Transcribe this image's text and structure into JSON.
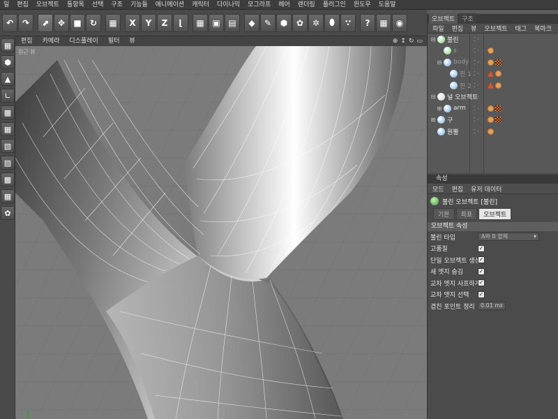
{
  "menubar": {
    "items": [
      "일",
      "편집",
      "오브젝트",
      "툴항목",
      "선택",
      "구조",
      "기능들",
      "애니메이션",
      "캐릭터",
      "다이나믹",
      "모그라프",
      "헤어",
      "렌더링",
      "플러그인",
      "윈도우",
      "도움말"
    ]
  },
  "toolbar": {
    "buttons": [
      {
        "name": "undo-icon",
        "glyph": "↶"
      },
      {
        "name": "redo-icon",
        "glyph": "↷"
      },
      {
        "name": "live-select-icon",
        "glyph": "⬈"
      },
      {
        "name": "move-icon",
        "glyph": "✥"
      },
      {
        "name": "scale-icon",
        "glyph": "■"
      },
      {
        "name": "rotate-icon",
        "glyph": "↻"
      },
      {
        "name": "clapboard-icon",
        "glyph": "▦"
      },
      {
        "name": "x-axis-icon",
        "glyph": "X"
      },
      {
        "name": "y-axis-icon",
        "glyph": "Y"
      },
      {
        "name": "z-axis-icon",
        "glyph": "Z"
      },
      {
        "name": "coordinate-system-icon",
        "glyph": "⌊"
      },
      {
        "name": "render-view-icon",
        "glyph": "▦"
      },
      {
        "name": "render-picture-viewer-icon",
        "glyph": "▣"
      },
      {
        "name": "render-settings-icon",
        "glyph": "▤"
      },
      {
        "name": "cube-primitive-icon",
        "glyph": "◆"
      },
      {
        "name": "spline-pen-icon",
        "glyph": "✎"
      },
      {
        "name": "subdivision-icon",
        "glyph": "⬢"
      },
      {
        "name": "array-icon",
        "glyph": "✿"
      },
      {
        "name": "deformer-icon",
        "glyph": "✲"
      },
      {
        "name": "scene-object-icon",
        "glyph": "⬮"
      },
      {
        "name": "particle-icon",
        "glyph": "∵"
      },
      {
        "name": "help-icon",
        "glyph": "?"
      },
      {
        "name": "calculator-icon",
        "glyph": "▦"
      },
      {
        "name": "globe-icon",
        "glyph": "◉"
      }
    ]
  },
  "lefttoolbar": {
    "buttons": [
      {
        "name": "make-editable-icon",
        "glyph": "▦"
      },
      {
        "name": "model-mode-icon",
        "glyph": "⬢"
      },
      {
        "name": "object-axis-icon",
        "glyph": "▲"
      },
      {
        "name": "texture-axis-icon",
        "glyph": "∟"
      },
      {
        "name": "points-mode-icon",
        "glyph": "▩"
      },
      {
        "name": "edges-mode-icon",
        "glyph": "▦"
      },
      {
        "name": "polygons-mode-icon",
        "glyph": "▧"
      },
      {
        "name": "uv-mode-icon",
        "glyph": "▨"
      },
      {
        "name": "enable-axis-icon",
        "glyph": "▩"
      },
      {
        "name": "tweak-mode-icon",
        "glyph": "▦"
      },
      {
        "name": "snap-icon",
        "glyph": "✿"
      }
    ]
  },
  "viewport": {
    "menu": [
      "편집",
      "카메라",
      "디스플레이",
      "필터",
      "뷰"
    ],
    "label": "원근 뷰",
    "nav_icons": [
      "⊕",
      "↕",
      "↻",
      "▭"
    ]
  },
  "object_manager": {
    "tabs": [
      "오브젝트",
      "구조"
    ],
    "menu": [
      "파일",
      "편집",
      "뷰",
      "오브젝트",
      "태그",
      "북마크"
    ],
    "rows": [
      {
        "indent": 0,
        "tree": "⊟",
        "icon_color": "#7fd07a",
        "name": "불린",
        "dim": false,
        "tags": []
      },
      {
        "indent": 1,
        "tree": "",
        "icon_color": "#7fd07a",
        "name": "s",
        "dim": true,
        "tags": [
          "b"
        ]
      },
      {
        "indent": 1,
        "tree": "⊟",
        "icon_color": "#6fb0e0",
        "name": "body",
        "dim": true,
        "tags": [
          "b",
          "c"
        ]
      },
      {
        "indent": 2,
        "tree": "",
        "icon_color": "#6fb0e0",
        "name": "핀 1",
        "dim": true,
        "tags": [
          "t",
          "b"
        ]
      },
      {
        "indent": 2,
        "tree": "",
        "icon_color": "#6fb0e0",
        "name": "핀 2",
        "dim": true,
        "tags": [
          "t",
          "b"
        ]
      },
      {
        "indent": 0,
        "tree": "⊟",
        "icon_color": "#cfcfcf",
        "name": "널 오브젝트",
        "dim": false,
        "tags": []
      },
      {
        "indent": 1,
        "tree": "⊞",
        "icon_color": "#6fb0e0",
        "name": "arm",
        "dim": false,
        "tags": [
          "b",
          "c"
        ]
      },
      {
        "indent": 0,
        "tree": "⊞",
        "icon_color": "#6fb0e0",
        "name": "구",
        "dim": false,
        "tags": [
          "b",
          "c"
        ]
      },
      {
        "indent": 0,
        "tree": "",
        "icon_color": "#6fb0e0",
        "name": "원뿔",
        "dim": false,
        "tags": [
          "b"
        ]
      }
    ]
  },
  "attribute_manager": {
    "title": "속성",
    "menu": [
      "모드",
      "편집",
      "유저 데이터"
    ],
    "object_title": "불린 오브젝트 [불린]",
    "tabs": [
      "기본",
      "좌표",
      "오브젝트"
    ],
    "active_tab": "오브젝트",
    "section": "오브젝트 속성",
    "fields": [
      {
        "label": "불린 타입",
        "type": "dropdown",
        "value": "A와 B 합체"
      },
      {
        "label": "고품질",
        "type": "check",
        "value": "✓"
      },
      {
        "label": "단일 오브젝트 생성",
        "type": "check",
        "value": "✓"
      },
      {
        "label": "새 엣지 숨김",
        "type": "check",
        "value": "✓"
      },
      {
        "label": "교차 엣지 사프하게",
        "type": "check",
        "value": "✓"
      },
      {
        "label": "교차 엣지 선택",
        "type": "check",
        "value": "✓"
      },
      {
        "label": "겹친 포인트 정리",
        "type": "number",
        "value": "0.01 m"
      }
    ]
  }
}
